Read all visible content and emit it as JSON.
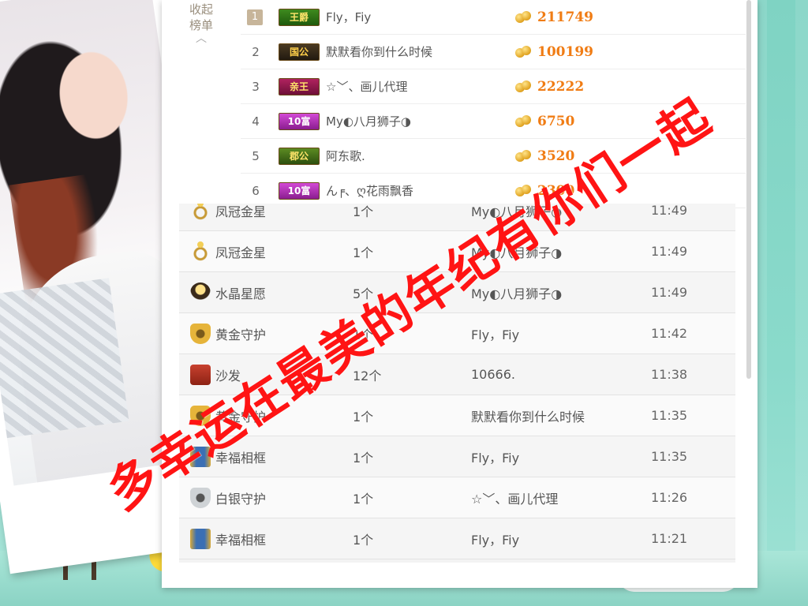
{
  "colors": {
    "accent_score": "#f07c14",
    "overlay_text": "#ff1414",
    "background": "#8adacb"
  },
  "ranking": {
    "side_label_line1": "收起",
    "side_label_line2": "榜单",
    "collapse_icon": "chevron-up-icon",
    "rows": [
      {
        "rank": "1",
        "badge": "王爵",
        "badge_style": "wang",
        "name": "Fly，Fiy",
        "score": "211749"
      },
      {
        "rank": "2",
        "badge": "国公",
        "badge_style": "guo",
        "name": "默默看你到什么时候",
        "score": "100199"
      },
      {
        "rank": "3",
        "badge": "亲王",
        "badge_style": "qin",
        "name": "☆﹀、画儿代理",
        "score": "22222"
      },
      {
        "rank": "4",
        "badge": "10富",
        "badge_style": "fu",
        "name": "My◐八月狮子◑",
        "score": "6750"
      },
      {
        "rank": "5",
        "badge": "郡公",
        "badge_style": "jun",
        "name": "阿东歌.",
        "score": "3520"
      },
      {
        "rank": "6",
        "badge": "10富",
        "badge_style": "fu",
        "name": "ん╒、ღ花雨飘香",
        "score": "2300"
      }
    ]
  },
  "gifts": {
    "rows": [
      {
        "icon": "ring-icon",
        "icon_style": "ring",
        "gift": "凤冠金星",
        "qty": "1个",
        "sender": "My◐八月狮子◑",
        "time": "11:49"
      },
      {
        "icon": "ring-icon",
        "icon_style": "ring",
        "gift": "凤冠金星",
        "qty": "1个",
        "sender": "My◐八月狮子◑",
        "time": "11:49"
      },
      {
        "icon": "crystal-ball-icon",
        "icon_style": "crystal",
        "gift": "水晶星愿",
        "qty": "5个",
        "sender": "My◐八月狮子◑",
        "time": "11:49"
      },
      {
        "icon": "gold-shield-icon",
        "icon_style": "gold-shield",
        "gift": "黄金守护",
        "qty": "1个",
        "sender": "Fly，Fiy",
        "time": "11:42"
      },
      {
        "icon": "sofa-icon",
        "icon_style": "sofa",
        "gift": "沙发",
        "qty": "12个",
        "sender": "10666.",
        "time": "11:38"
      },
      {
        "icon": "gold-shield-icon",
        "icon_style": "gold-shield",
        "gift": "黄金守护",
        "qty": "1个",
        "sender": "默默看你到什么时候",
        "time": "11:35"
      },
      {
        "icon": "photo-frame-icon",
        "icon_style": "frame",
        "gift": "幸福相框",
        "qty": "1个",
        "sender": "Fly，Fiy",
        "time": "11:35"
      },
      {
        "icon": "silver-shield-icon",
        "icon_style": "silver-shield",
        "gift": "白银守护",
        "qty": "1个",
        "sender": "☆﹀、画儿代理",
        "time": "11:26"
      },
      {
        "icon": "photo-frame-icon",
        "icon_style": "frame",
        "gift": "幸福相框",
        "qty": "1个",
        "sender": "Fly，Fiy",
        "time": "11:21"
      }
    ]
  },
  "overlay": {
    "text": "多幸运在最美的年纪有你们一起"
  }
}
